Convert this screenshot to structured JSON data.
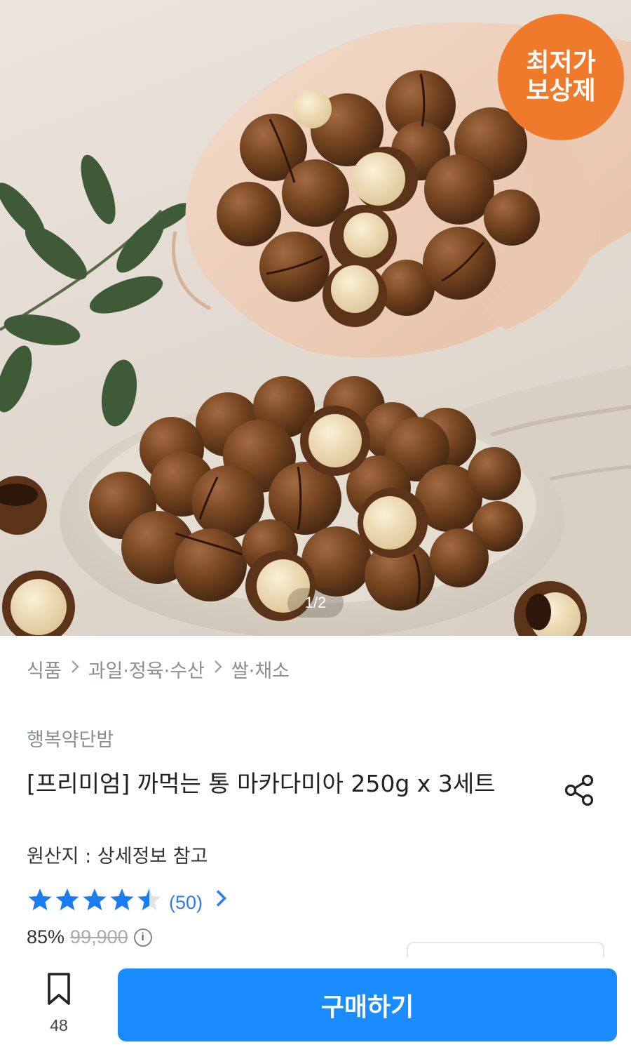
{
  "hero": {
    "badge_text": "최저가\n보상제",
    "pager": "1/2",
    "colors": {
      "badge": "#f07a2b",
      "nut_shell": "#6b3f24",
      "nut_kernel": "#efdcb3"
    }
  },
  "breadcrumb": {
    "items": [
      "식품",
      "과일·정육·수산",
      "쌀·채소"
    ],
    "separator_icon": "chevron-right-icon"
  },
  "product": {
    "seller": "행복약단밤",
    "title": "[프리미엄] 까먹는 통 마카다미아 250g x 3세트",
    "origin": "원산지 : 상세정보 참고",
    "share_icon": "share-icon",
    "rating": {
      "value": 4.5,
      "max": 5,
      "count_label": "(50)",
      "star_color": "#1a7cf0"
    },
    "price": {
      "discount": "85%",
      "original": "99,900"
    }
  },
  "bottom_bar": {
    "bookmark_count": "48",
    "bookmark_icon": "bookmark-icon",
    "buy_label": "구매하기",
    "buy_color": "#1a8cff"
  }
}
